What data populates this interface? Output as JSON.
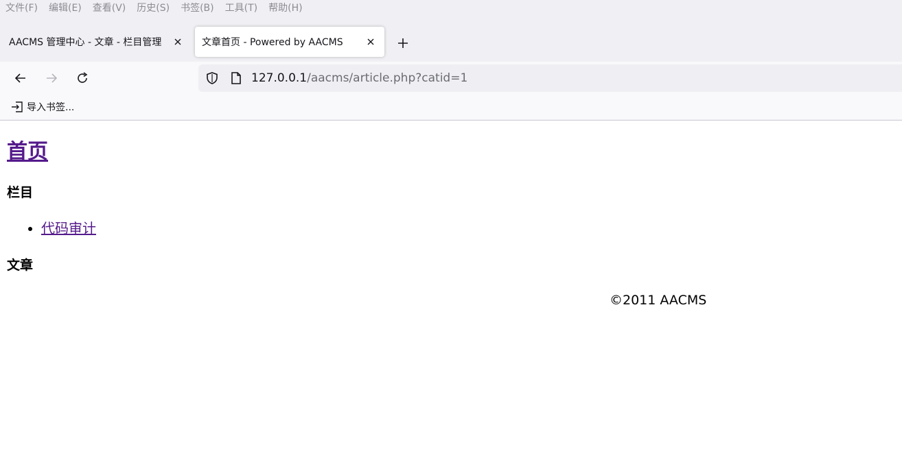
{
  "menubar": {
    "items": [
      "文件(F)",
      "编辑(E)",
      "查看(V)",
      "历史(S)",
      "书签(B)",
      "工具(T)",
      "帮助(H)"
    ]
  },
  "tabs": [
    {
      "title": "AACMS 管理中心 - 文章 - 栏目管理",
      "active": false
    },
    {
      "title": "文章首页 - Powered by AACMS",
      "active": true
    }
  ],
  "urlbar": {
    "host": "127.0.0.1",
    "path": "/aacms/article.php?catid=1"
  },
  "bookmarks": {
    "import_label": "导入书签..."
  },
  "page": {
    "home_link": "首页",
    "categories_heading": "栏目",
    "categories": [
      "代码审计"
    ],
    "articles_heading": "文章",
    "footer": "©2011 AACMS"
  },
  "colors": {
    "chrome_bg": "#f0f0f4",
    "visited_link": "#551a8b"
  }
}
